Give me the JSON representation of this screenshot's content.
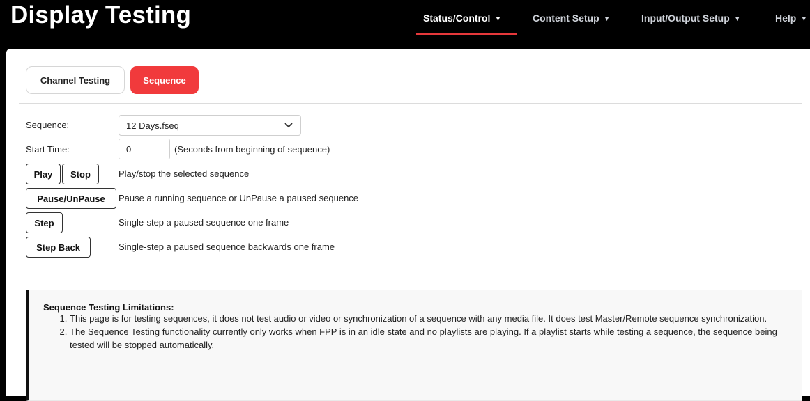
{
  "app": {
    "title": "Display Testing"
  },
  "nav": {
    "items": [
      {
        "label": "Status/Control",
        "active": true
      },
      {
        "label": "Content Setup",
        "active": false
      },
      {
        "label": "Input/Output Setup",
        "active": false
      },
      {
        "label": "Help",
        "active": false
      }
    ],
    "caret": "▼",
    "accent": "#e6383b"
  },
  "tabs": [
    {
      "label": "Channel Testing",
      "active": false
    },
    {
      "label": "Sequence",
      "active": true
    }
  ],
  "form": {
    "sequence_label": "Sequence:",
    "sequence_value": "12 Days.fseq",
    "start_time_label": "Start Time:",
    "start_time_value": "0",
    "start_time_help": "(Seconds from beginning of sequence)"
  },
  "controls": [
    {
      "buttons": [
        "Play",
        "Stop"
      ],
      "description": "Play/stop the selected sequence"
    },
    {
      "buttons": [
        "Pause/UnPause"
      ],
      "description": "Pause a running sequence or UnPause a paused sequence"
    },
    {
      "buttons": [
        "Step"
      ],
      "description": "Single-step a paused sequence one frame"
    },
    {
      "buttons": [
        "Step Back"
      ],
      "description": "Single-step a paused sequence backwards one frame"
    }
  ],
  "limitations": {
    "title": "Sequence Testing Limitations:",
    "items": [
      "This page is for testing sequences, it does not test audio or video or synchronization of a sequence with any media file. It does test Master/Remote sequence synchronization.",
      "The Sequence Testing functionality currently only works when FPP is in an idle state and no playlists are playing. If a playlist starts while testing a sequence, the sequence being tested will be stopped automatically."
    ]
  },
  "colors": {
    "accent": "#f13a3c",
    "header_bg": "#000000",
    "panel_bg": "#ffffff"
  }
}
